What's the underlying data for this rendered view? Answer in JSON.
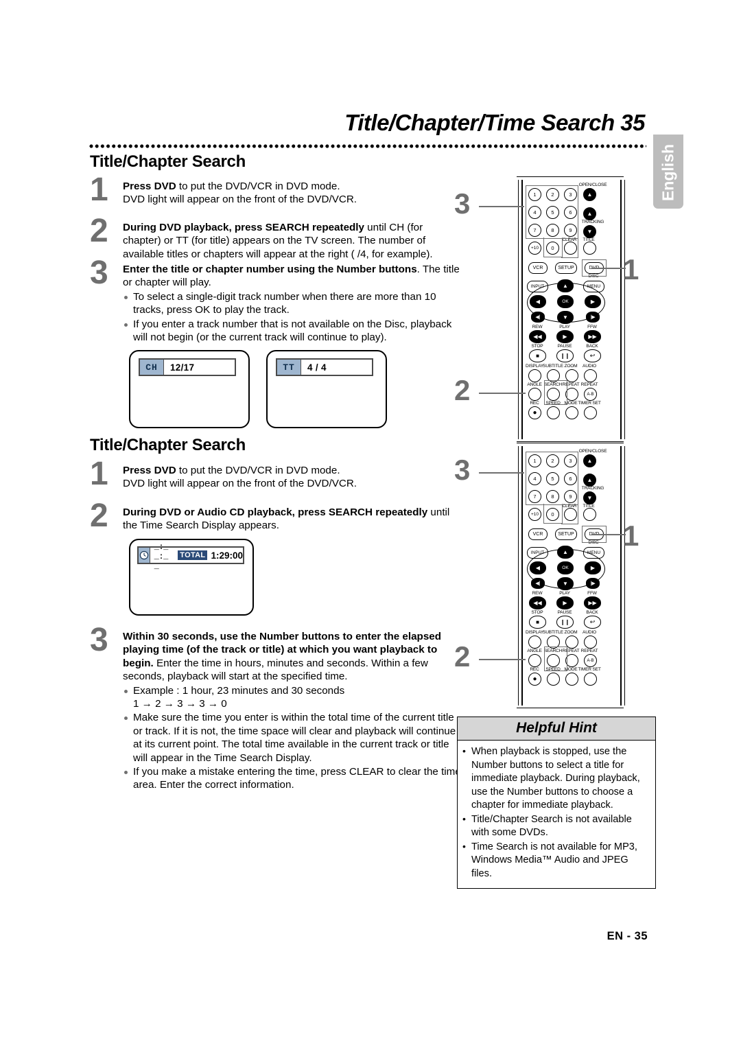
{
  "header": {
    "title": "Title/Chapter/Time Search 35",
    "language_tab": "English"
  },
  "footer": {
    "page_label": "EN - 35"
  },
  "sections": [
    {
      "heading": "Title/Chapter Search",
      "steps": [
        {
          "num": "1",
          "bold": "Press DVD",
          "rest": " to put the DVD/VCR in DVD mode.",
          "line2": "DVD light will appear on the front of the DVD/VCR."
        },
        {
          "num": "2",
          "bold": "During DVD playback, press SEARCH repeatedly",
          "rest": " until CH (for chapter) or TT (for title) appears on the TV screen. The number of available titles or chapters will appear at the right ( /4, for example)."
        },
        {
          "num": "3",
          "bold": "Enter the title or chapter number using the Number buttons",
          "rest": ". The title or chapter will play.",
          "bullets": [
            "To select a single-digit track number when there are more than 10 tracks, press OK to play the track.",
            "If you enter a track number that is not available on the Disc, playback will not begin (or the current track will continue to play)."
          ]
        }
      ],
      "screens": [
        {
          "tag": "CH",
          "value": "12/17"
        },
        {
          "tag": "TT",
          "value": "4 / 4"
        }
      ]
    },
    {
      "heading": "Title/Chapter Search",
      "steps": [
        {
          "num": "1",
          "bold": "Press DVD",
          "rest": " to put the DVD/VCR in DVD mode.",
          "line2": "DVD light will appear on the front of the DVD/VCR."
        },
        {
          "num": "2",
          "bold": "During DVD or Audio CD playback, press SEARCH repeatedly",
          "rest": " until the Time Search Display appears."
        },
        {
          "num": "3",
          "bold": "Within 30 seconds, use the Number buttons to enter the elapsed playing time (of the track or title) at which you want playback to begin.",
          "rest": " Enter the time in hours, minutes and seconds. Within a few seconds, playback will start at the specified time.",
          "bullets": [
            "Example : 1 hour, 23 minutes and 30 seconds",
            "Make sure the time you enter is within the total time of the current title or track. If it is not, the time space will clear and playback will continue at its current point. The total time available in the current track or title will appear in the Time Search Display.",
            "If you make a mistake entering the time, press CLEAR to clear the time area. Enter the correct information."
          ],
          "example_sequence": "1 → 2 → 3 → 3 → 0"
        }
      ],
      "time_display": {
        "icon": "clock-icon",
        "blanks": "_:_ _:_ _",
        "total_label": "TOTAL",
        "total_value": "1:29:00"
      }
    }
  ],
  "helpful_hint": {
    "title": "Helpful Hint",
    "items": [
      "When playback is stopped, use the Number buttons to select a title for immediate playback. During playback, use the Number buttons to choose a chapter for immediate playback.",
      "Title/Chapter Search is not available with some DVDs.",
      "Time Search is not available for MP3, Windows Media™ Audio and JPEG files."
    ]
  },
  "remote": {
    "callouts": {
      "one": "1",
      "two": "2",
      "three": "3"
    },
    "keys": {
      "n1": "1",
      "n2": "2",
      "n3": "3",
      "n4": "4",
      "n5": "5",
      "n6": "6",
      "n7": "7",
      "n8": "8",
      "n9": "9",
      "plus10": "+10",
      "n0": "0",
      "clear": "CLEAR",
      "title": "TITLE",
      "open_close": "OPEN/CLOSE",
      "tracking": "TRACKING",
      "vcr": "VCR",
      "setup": "SETUP",
      "dvd": "DVD",
      "disc": "DISC",
      "input": "INPUT",
      "menu": "MENU",
      "ok": "OK",
      "rew": "REW",
      "play": "PLAY",
      "ffw": "FFW",
      "stop": "STOP",
      "pause": "PAUSE",
      "back": "BACK",
      "display": "DISPLAY",
      "subtitle": "SUBTITLE",
      "zoom": "ZOOM",
      "audio": "AUDIO",
      "angle": "ANGLE",
      "search": "SEARCH",
      "repeat": "REPEAT",
      "repeat2": "REPEAT",
      "ab": "A-B",
      "rec": "REC",
      "speed": "SPEED",
      "mode": "MODE",
      "timer_set": "TIMER SET"
    }
  }
}
